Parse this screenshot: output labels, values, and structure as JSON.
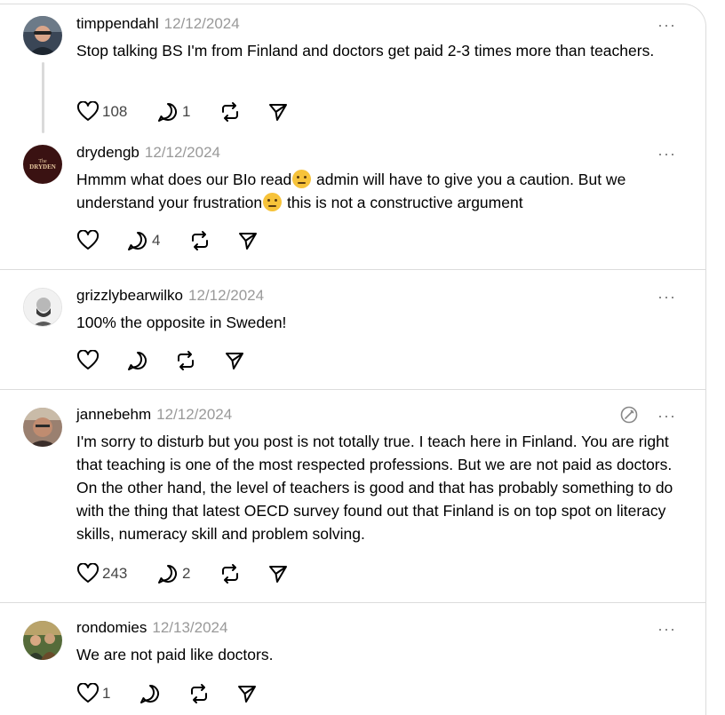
{
  "posts": [
    {
      "username": "timppendahl",
      "date": "12/12/2024",
      "text": "Stop talking BS I'm from Finland and doctors get paid 2-3 times more than teachers.",
      "likes": "108",
      "replies": "1",
      "reposts": "",
      "shares": ""
    },
    {
      "username": "drydengb",
      "date": "12/12/2024",
      "text_part1": "Hmmm what does our BIo read",
      "text_part2": " admin will have to give you a caution. But we understand your frustration",
      "text_part3": " this is not a constructive argument",
      "avatar_text": "The DRYDEN",
      "likes": "",
      "replies": "4"
    },
    {
      "username": "grizzlybearwilko",
      "date": "12/12/2024",
      "text": "100% the opposite in Sweden!",
      "likes": "",
      "replies": ""
    },
    {
      "username": "jannebehm",
      "date": "12/12/2024",
      "text": "I'm sorry to disturb but you post is not totally true. I teach here in Finland. You are right that teaching is one of the most respected professions. But we are not paid as doctors. On the other hand, the level of teachers is good and that has probably something to do with the thing that latest OECD survey found out that Finland is on top spot on literacy skills, numeracy skill and problem solving.",
      "likes": "243",
      "replies": "2"
    },
    {
      "username": "rondomies",
      "date": "12/13/2024",
      "text": "We are not paid like doctors.",
      "likes": "1",
      "replies": ""
    }
  ],
  "more_icon": "···",
  "icons": [
    "heart-icon",
    "comment-icon",
    "repost-icon",
    "share-icon",
    "more-icon",
    "edit-icon"
  ],
  "colors": {
    "text": "#000000",
    "muted": "#999999",
    "divider": "#dcdcdc",
    "icon": "#000000"
  }
}
